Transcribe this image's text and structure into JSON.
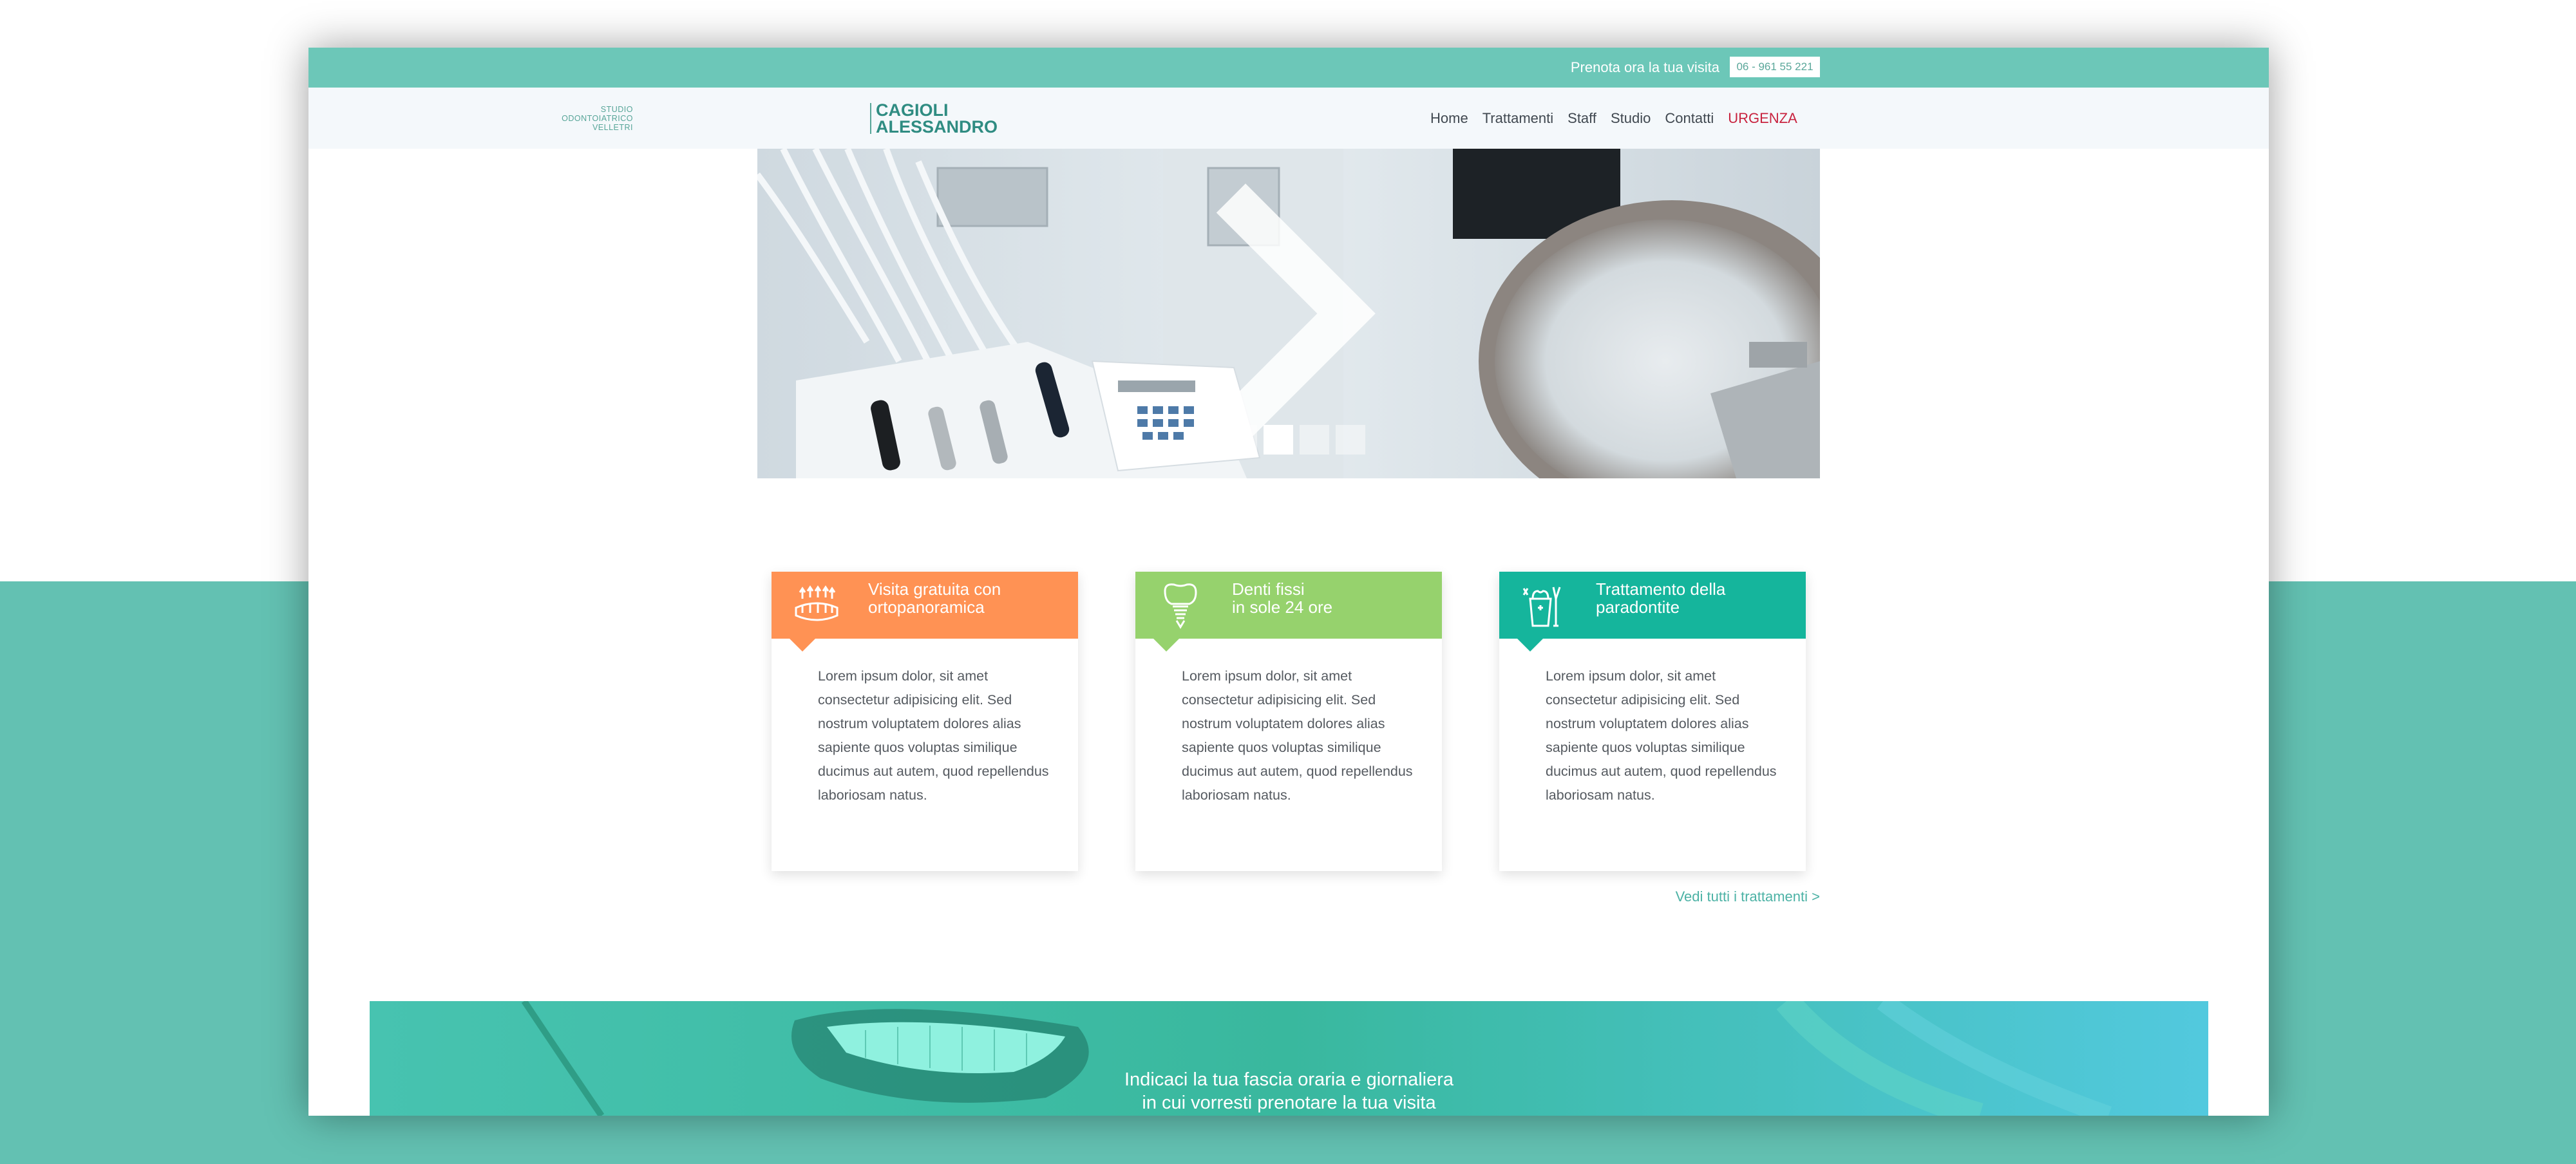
{
  "topbar": {
    "cta_text": "Prenota ora la tua visita",
    "phone": "06 - 961 55 221"
  },
  "logo": {
    "line1": "STUDIO",
    "line2": "ODONTOIATRICO",
    "line3": "VELLETRI",
    "name1": "CAGIOLI",
    "name2": "ALESSANDRO"
  },
  "nav": {
    "items": [
      "Home",
      "Trattamenti",
      "Staff",
      "Studio",
      "Contatti"
    ],
    "urgent": "URGENZA"
  },
  "slider": {
    "slide_count": 4,
    "active_index": 1
  },
  "cards": [
    {
      "title_line1": "Visita gratuita con",
      "title_line2": "ortopanoramica",
      "icon": "teeth-xray-icon",
      "color": "#ff9254",
      "body": "Lorem ipsum dolor, sit amet consectetur adipisicing elit. Sed nostrum voluptatem dolores alias sapiente quos voluptas similique ducimus aut autem, quod repellendus laboriosam natus."
    },
    {
      "title_line1": "Denti fissi",
      "title_line2": "in sole 24 ore",
      "icon": "tooth-implant-icon",
      "color": "#96d26d",
      "body": "Lorem ipsum dolor, sit amet consectetur adipisicing elit. Sed nostrum voluptatem dolores alias sapiente quos voluptas similique ducimus aut autem, quod repellendus laboriosam natus."
    },
    {
      "title_line1": "Trattamento della",
      "title_line2": "paradontite",
      "icon": "dental-tools-icon",
      "color": "#15b59c",
      "body": "Lorem ipsum dolor, sit amet consectetur adipisicing elit. Sed nostrum voluptatem dolores alias sapiente quos voluptas similique ducimus aut autem, quod repellendus laboriosam natus."
    }
  ],
  "more_link": "Vedi tutti i trattamenti >",
  "banner": {
    "line1": "Indicaci la tua fascia oraria e giornaliera",
    "line2": "in cui vorresti prenotare la tua visita"
  }
}
